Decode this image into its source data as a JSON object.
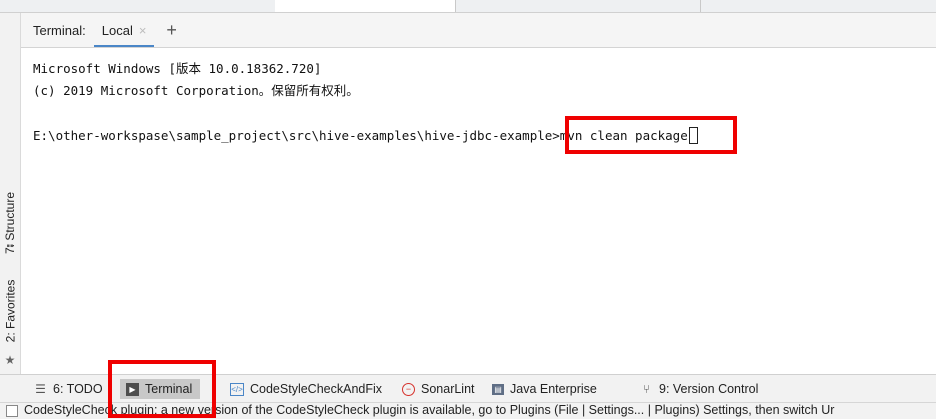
{
  "terminal": {
    "title": "Terminal:",
    "tabs": [
      {
        "label": "Local",
        "close": "×"
      }
    ],
    "add_tab": "+",
    "lines": [
      "Microsoft Windows [版本 10.0.18362.720]",
      "(c) 2019 Microsoft Corporation。保留所有权利。"
    ],
    "prompt_path": "E:\\other-workspase\\sample_project\\src\\hive-examples\\hive-jdbc-example>",
    "command": "mvn clean package"
  },
  "left_tool_windows": [
    {
      "label": "7: Structure",
      "icon": "structure-icon"
    },
    {
      "label": "2: Favorites",
      "icon": "star-icon"
    }
  ],
  "bottom_tools": [
    {
      "label": "6: TODO",
      "icon": "list-icon",
      "active": false
    },
    {
      "label": "Terminal",
      "icon": "terminal-icon",
      "active": true
    },
    {
      "label": "CodeStyleCheckAndFix",
      "icon": "codestyle-icon",
      "active": false
    },
    {
      "label": "SonarLint",
      "icon": "sonarlint-icon",
      "active": false
    },
    {
      "label": "Java Enterprise",
      "icon": "java-enterprise-icon",
      "active": false
    },
    {
      "label": "9: Version Control",
      "icon": "version-control-icon",
      "active": false
    }
  ],
  "status": {
    "message": "CodeStyleCheck plugin: a new version of the CodeStyleCheck plugin is available, go to Plugins (File | Settings... | Plugins) Settings, then switch Ur"
  },
  "colors": {
    "highlight": "#ef0000",
    "active_tab_underline": "#4a86c7",
    "active_tool_bg": "#c8c8c8"
  }
}
